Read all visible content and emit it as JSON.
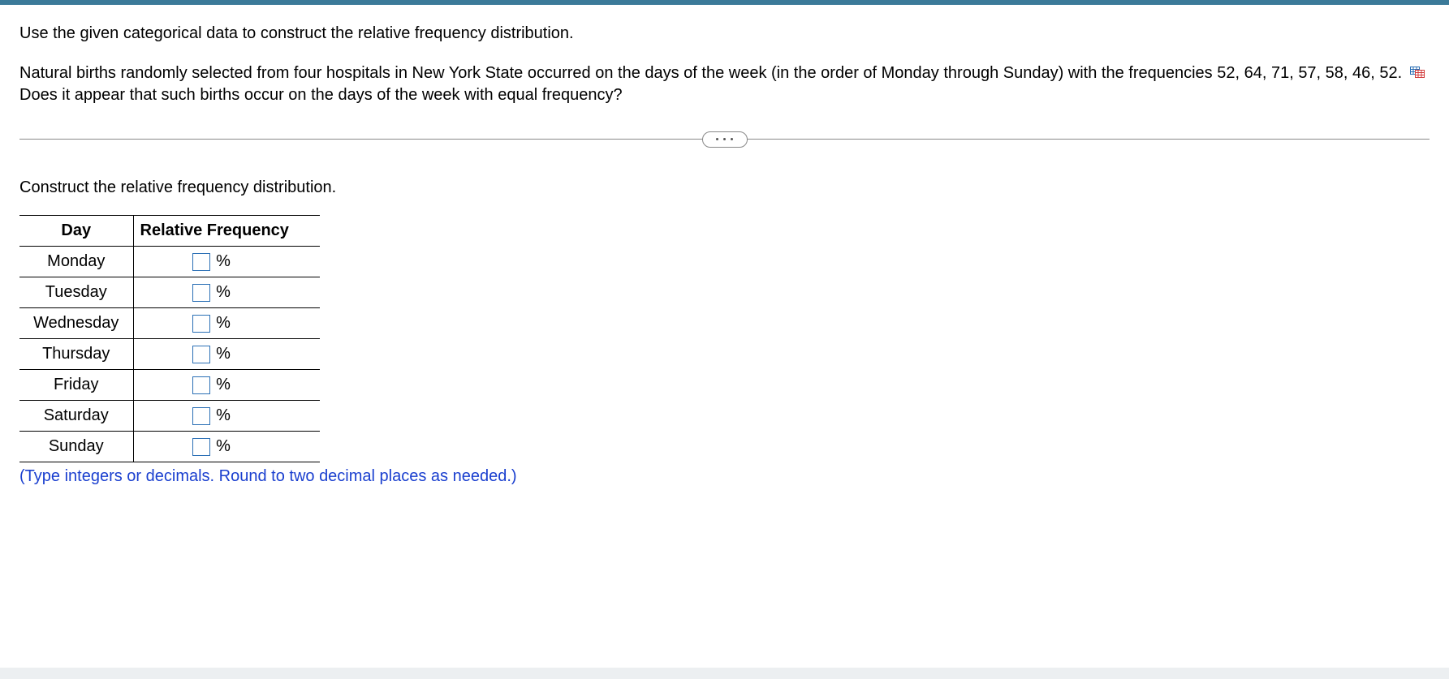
{
  "question": {
    "intro": "Use the given categorical data to construct the relative frequency distribution.",
    "body_pre_icon": "Natural births randomly selected from four hospitals in New York State occurred on the days of the week (in the order of Monday through Sunday) with the frequencies 52, 64, 71, 57, 58, 46, 52.",
    "body_post_icon": "Does it appear that such births occur on the days of the week with equal frequency?"
  },
  "section_prompt": "Construct the relative frequency distribution.",
  "table": {
    "headers": {
      "day": "Day",
      "rel": "Relative Frequency"
    },
    "rows": [
      {
        "day": "Monday",
        "unit": "%"
      },
      {
        "day": "Tuesday",
        "unit": "%"
      },
      {
        "day": "Wednesday",
        "unit": "%"
      },
      {
        "day": "Thursday",
        "unit": "%"
      },
      {
        "day": "Friday",
        "unit": "%"
      },
      {
        "day": "Saturday",
        "unit": "%"
      },
      {
        "day": "Sunday",
        "unit": "%"
      }
    ]
  },
  "hint": "(Type integers or decimals. Round to two decimal places as needed.)"
}
